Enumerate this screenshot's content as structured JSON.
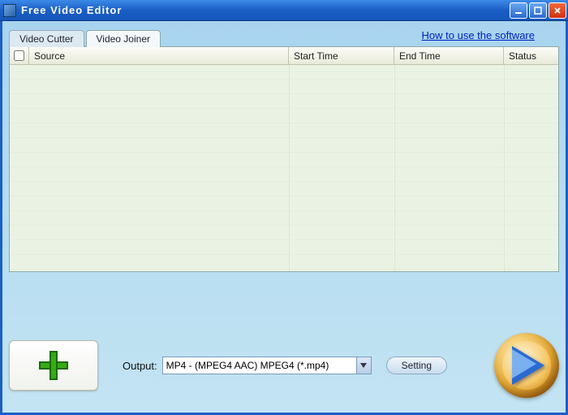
{
  "window": {
    "title": "Free Video Editor"
  },
  "tabs": {
    "cutter": "Video Cutter",
    "joiner": "Video Joiner",
    "active": "joiner"
  },
  "help_link": "How to use the software",
  "grid": {
    "headers": {
      "source": "Source",
      "start": "Start Time",
      "end": "End Time",
      "status": "Status"
    },
    "rows": []
  },
  "output": {
    "label": "Output:",
    "value": "MP4 - (MPEG4 AAC) MPEG4 (*.mp4)"
  },
  "buttons": {
    "setting": "Setting"
  }
}
